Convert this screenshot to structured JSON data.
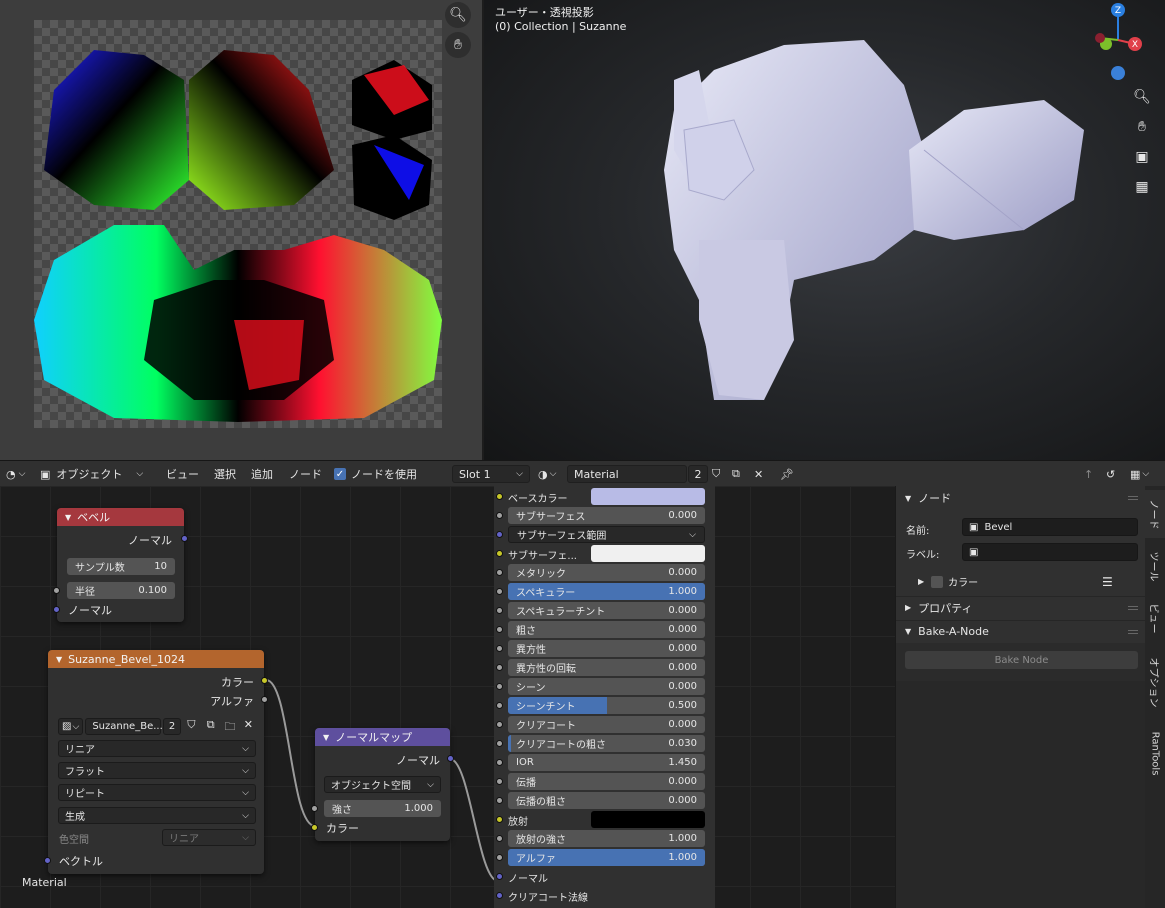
{
  "uv_editor": {
    "tools": [
      "zoom-icon",
      "hand-icon"
    ]
  },
  "viewport": {
    "view_name": "ユーザー・透視投影",
    "collection_info": "(0) Collection | Suzanne",
    "gizmo": {
      "z": "Z",
      "x": "X"
    }
  },
  "node_header": {
    "object_mode": "オブジェクト",
    "menu": [
      "ビュー",
      "選択",
      "追加",
      "ノード"
    ],
    "use_nodes_label": "ノードを使用",
    "slot": "Slot 1",
    "material": "Material",
    "users": "2"
  },
  "nodes": {
    "bevel": {
      "title": "ベベル",
      "out_normal": "ノーマル",
      "samples_label": "サンプル数",
      "samples_value": "10",
      "radius_label": "半径",
      "radius_value": "0.100",
      "in_normal": "ノーマル",
      "color": "#a5383e"
    },
    "image": {
      "title": "Suzanne_Bevel_1024",
      "out_color": "カラー",
      "out_alpha": "アルファ",
      "image_name": "Suzanne_Be...",
      "users": "2",
      "interpolation": "リニア",
      "projection": "フラット",
      "extension": "リピート",
      "source": "生成",
      "color_space_label": "色空間",
      "color_space_value": "リニア",
      "in_vector": "ベクトル",
      "color": "#b3652d"
    },
    "normal_map": {
      "title": "ノーマルマップ",
      "out_normal": "ノーマル",
      "space": "オブジェクト空間",
      "strength_label": "強さ",
      "strength_value": "1.000",
      "in_color": "カラー",
      "color": "#5e4f9e"
    },
    "tree_label": "Material"
  },
  "bsdf_inputs": [
    {
      "label": "ベースカラー",
      "kind": "color",
      "socket": "col",
      "swatch": "#b8bbe6"
    },
    {
      "label": "サブサーフェス",
      "kind": "value",
      "socket": "flt",
      "value": "0.000",
      "fill": 0
    },
    {
      "label": "サブサーフェス範囲",
      "kind": "dropdown",
      "socket": "vec"
    },
    {
      "label": "サブサーフェ...",
      "kind": "color",
      "socket": "col",
      "swatch": "#f0f0f0"
    },
    {
      "label": "メタリック",
      "kind": "value",
      "socket": "flt",
      "value": "0.000",
      "fill": 0
    },
    {
      "label": "スペキュラー",
      "kind": "value",
      "socket": "flt",
      "value": "1.000",
      "fill": 1
    },
    {
      "label": "スペキュラーチント",
      "kind": "value",
      "socket": "flt",
      "value": "0.000",
      "fill": 0
    },
    {
      "label": "粗さ",
      "kind": "value",
      "socket": "flt",
      "value": "0.000",
      "fill": 0
    },
    {
      "label": "異方性",
      "kind": "value",
      "socket": "flt",
      "value": "0.000",
      "fill": 0
    },
    {
      "label": "異方性の回転",
      "kind": "value",
      "socket": "flt",
      "value": "0.000",
      "fill": 0
    },
    {
      "label": "シーン",
      "kind": "value",
      "socket": "flt",
      "value": "0.000",
      "fill": 0
    },
    {
      "label": "シーンチント",
      "kind": "value",
      "socket": "flt",
      "value": "0.500",
      "fill": 0.5
    },
    {
      "label": "クリアコート",
      "kind": "value",
      "socket": "flt",
      "value": "0.000",
      "fill": 0
    },
    {
      "label": "クリアコートの粗さ",
      "kind": "value",
      "socket": "flt",
      "value": "0.030",
      "fill": 0.03
    },
    {
      "label": "IOR",
      "kind": "value",
      "socket": "flt",
      "value": "1.450",
      "fill": 0
    },
    {
      "label": "伝播",
      "kind": "value",
      "socket": "flt",
      "value": "0.000",
      "fill": 0
    },
    {
      "label": "伝播の粗さ",
      "kind": "value",
      "socket": "flt",
      "value": "0.000",
      "fill": 0
    },
    {
      "label": "放射",
      "kind": "color",
      "socket": "col",
      "swatch": "#000000"
    },
    {
      "label": "放射の強さ",
      "kind": "value",
      "socket": "flt",
      "value": "1.000",
      "fill": 0
    },
    {
      "label": "アルファ",
      "kind": "value",
      "socket": "flt",
      "value": "1.000",
      "fill": 1
    },
    {
      "label": "ノーマル",
      "kind": "socket",
      "socket": "vec"
    },
    {
      "label": "クリアコート法線",
      "kind": "socket",
      "socket": "vec"
    }
  ],
  "npanel": {
    "node_section": "ノード",
    "name_label": "名前:",
    "name_value": "Bevel",
    "label_label": "ラベル:",
    "label_value": "",
    "color_label": "カラー",
    "properties_section": "プロパティ",
    "bake_section": "Bake-A-Node",
    "bake_button": "Bake Node"
  },
  "vertical_tabs": [
    "ノード",
    "ツール",
    "ビュー",
    "オプション",
    "RanTools"
  ]
}
